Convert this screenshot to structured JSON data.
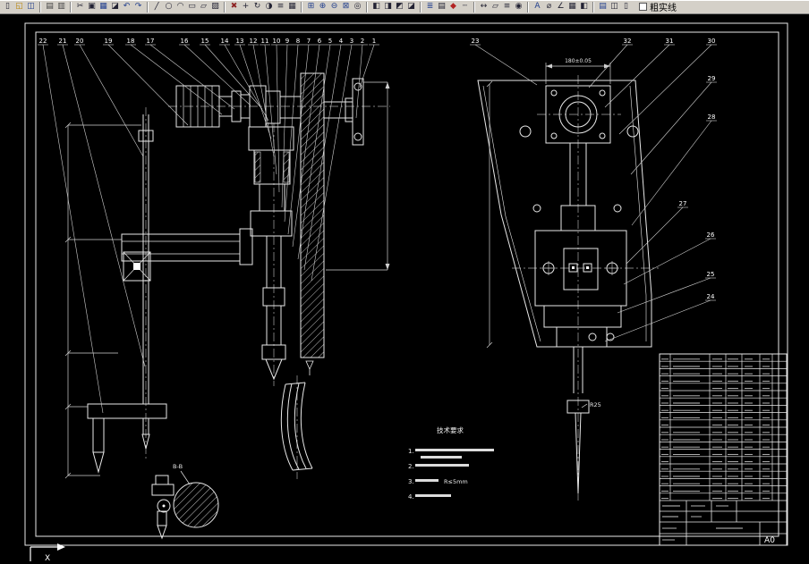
{
  "toolbar": {
    "layer_label": "粗实线",
    "icons": [
      {
        "name": "new",
        "glyph": "▯"
      },
      {
        "name": "open",
        "glyph": "◱",
        "color": "#b8860b"
      },
      {
        "name": "save",
        "glyph": "◫",
        "color": "#23408e"
      },
      {
        "type": "sep"
      },
      {
        "name": "print",
        "glyph": "▤",
        "color": "#444444"
      },
      {
        "name": "print-preview",
        "glyph": "▥",
        "color": "#444444"
      },
      {
        "type": "sep"
      },
      {
        "name": "cut",
        "glyph": "✂"
      },
      {
        "name": "copy",
        "glyph": "▣"
      },
      {
        "name": "paste",
        "glyph": "▦",
        "color": "#23408e"
      },
      {
        "name": "match-properties",
        "glyph": "◪"
      },
      {
        "name": "undo",
        "glyph": "↶",
        "color": "#23408e"
      },
      {
        "name": "redo",
        "glyph": "↷",
        "color": "#23408e"
      },
      {
        "type": "sep"
      },
      {
        "name": "line",
        "glyph": "╱"
      },
      {
        "name": "circle",
        "glyph": "○"
      },
      {
        "name": "arc",
        "glyph": "◠"
      },
      {
        "name": "rectangle",
        "glyph": "▭"
      },
      {
        "name": "polygon",
        "glyph": "▱"
      },
      {
        "name": "hatch",
        "glyph": "▨"
      },
      {
        "type": "sep"
      },
      {
        "name": "erase",
        "glyph": "✖",
        "color": "#8e2323"
      },
      {
        "name": "move",
        "glyph": "+"
      },
      {
        "name": "rotate",
        "glyph": "↻"
      },
      {
        "name": "mirror",
        "glyph": "◑"
      },
      {
        "name": "offset",
        "glyph": "≡"
      },
      {
        "name": "array",
        "glyph": "▦"
      },
      {
        "type": "sep"
      },
      {
        "name": "zoom-window",
        "glyph": "⊞",
        "color": "#23408e"
      },
      {
        "name": "zoom-in",
        "glyph": "⊕",
        "color": "#23408e"
      },
      {
        "name": "zoom-out",
        "glyph": "⊖",
        "color": "#23408e"
      },
      {
        "name": "zoom-extents",
        "glyph": "⊠",
        "color": "#23408e"
      },
      {
        "name": "pan",
        "glyph": "◎"
      },
      {
        "type": "sep"
      },
      {
        "name": "view-top",
        "glyph": "◧"
      },
      {
        "name": "view-front",
        "glyph": "◨"
      },
      {
        "name": "view-side",
        "glyph": "◩"
      },
      {
        "name": "view-iso",
        "glyph": "◪"
      },
      {
        "type": "sep"
      },
      {
        "name": "layers",
        "glyph": "≣",
        "color": "#23408e"
      },
      {
        "name": "layer-properties",
        "glyph": "▤"
      },
      {
        "name": "color-control",
        "glyph": "◆",
        "color": "#b22222"
      },
      {
        "name": "linetype",
        "glyph": "┄"
      },
      {
        "type": "sep"
      },
      {
        "name": "distance",
        "glyph": "↔"
      },
      {
        "name": "area",
        "glyph": "▱"
      },
      {
        "name": "list",
        "glyph": "≡"
      },
      {
        "name": "locate-point",
        "glyph": "◉"
      },
      {
        "type": "sep"
      },
      {
        "name": "text",
        "glyph": "A",
        "color": "#23408e"
      },
      {
        "name": "dimension",
        "glyph": "⌀"
      },
      {
        "name": "angle-dimension",
        "glyph": "∠"
      },
      {
        "name": "table",
        "glyph": "▦"
      },
      {
        "name": "block",
        "glyph": "◧"
      },
      {
        "type": "sep"
      },
      {
        "name": "properties",
        "glyph": "▤",
        "color": "#23408e"
      },
      {
        "name": "design-center",
        "glyph": "◫"
      },
      {
        "name": "tool-palettes",
        "glyph": "▯"
      }
    ]
  },
  "drawing": {
    "left_balloons": [
      "22",
      "21",
      "20",
      "19",
      "18",
      "17",
      "16",
      "15",
      "14",
      "13",
      "12",
      "11",
      "10",
      "9",
      "8",
      "7",
      "6",
      "5",
      "4",
      "3",
      "2",
      "1"
    ],
    "right_balloons": [
      "23",
      "32",
      "31",
      "30",
      "29",
      "28",
      "27",
      "26",
      "25",
      "24"
    ],
    "dim_top": "180±0.05",
    "radius_label": "R25",
    "detail_label": "B-B",
    "tech_requirements": {
      "title": "技术要求",
      "item1": "1.",
      "item2": "2.",
      "item3": "3.",
      "item3_note": "R≤5mm",
      "item4": "4."
    },
    "title_block": {
      "sheet_size": "A0"
    },
    "ucs_label": "X"
  }
}
